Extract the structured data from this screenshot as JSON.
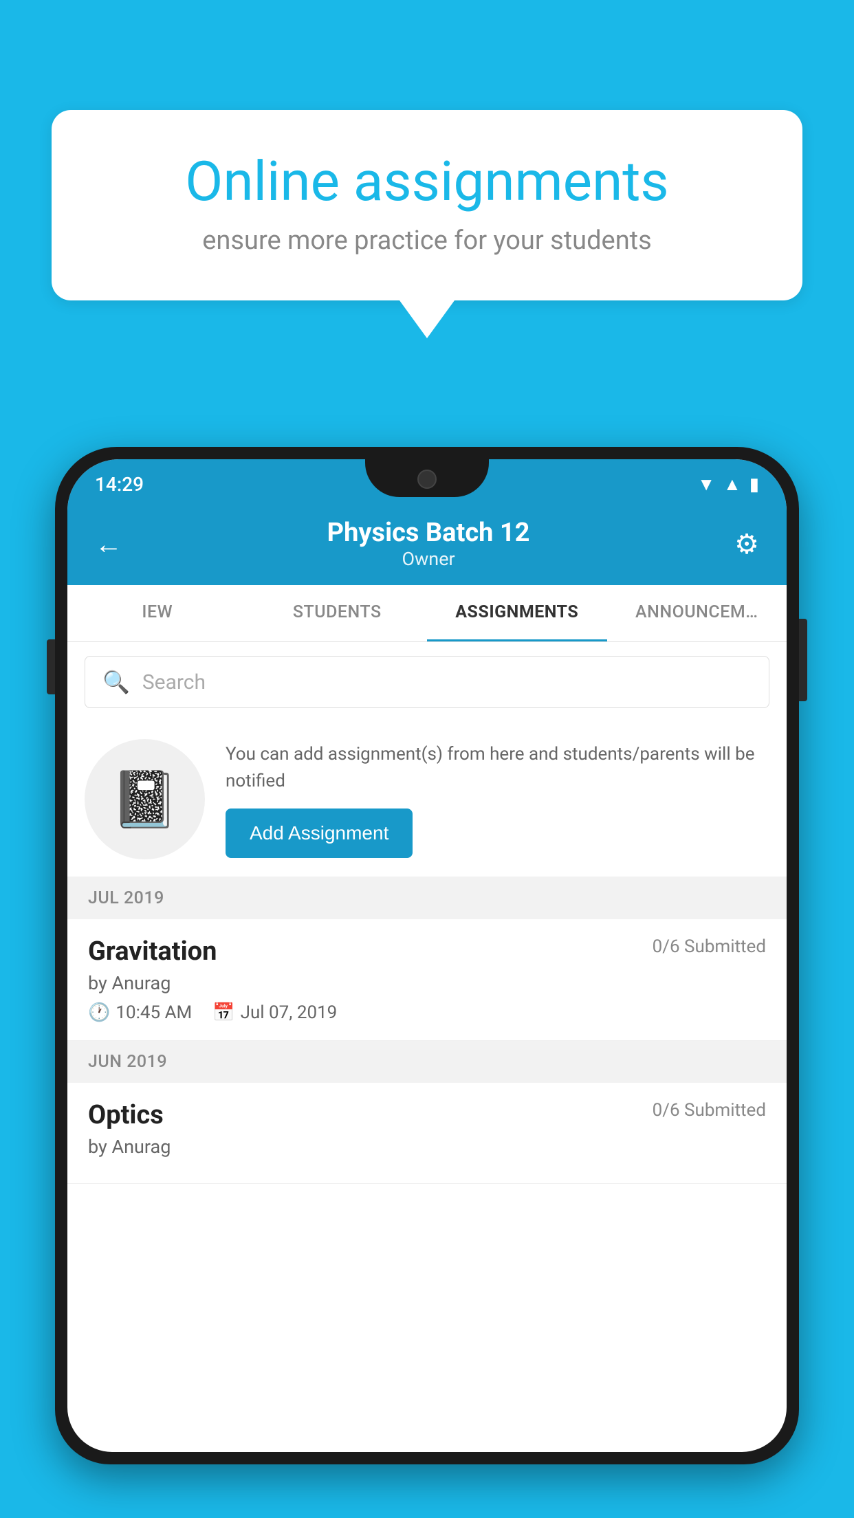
{
  "background_color": "#1ab8e8",
  "speech_bubble": {
    "title": "Online assignments",
    "subtitle": "ensure more practice for your students"
  },
  "status_bar": {
    "time": "14:29",
    "icons": [
      "wifi",
      "signal",
      "battery"
    ]
  },
  "header": {
    "title": "Physics Batch 12",
    "subtitle": "Owner",
    "back_label": "←",
    "settings_label": "⚙"
  },
  "tabs": [
    {
      "label": "IEW",
      "active": false
    },
    {
      "label": "STUDENTS",
      "active": false
    },
    {
      "label": "ASSIGNMENTS",
      "active": true
    },
    {
      "label": "ANNOUNCEM…",
      "active": false
    }
  ],
  "search": {
    "placeholder": "Search"
  },
  "promo": {
    "description": "You can add assignment(s) from here and students/parents will be notified",
    "button_label": "Add Assignment"
  },
  "sections": [
    {
      "header": "JUL 2019",
      "assignments": [
        {
          "name": "Gravitation",
          "submitted": "0/6 Submitted",
          "by": "by Anurag",
          "time": "10:45 AM",
          "date": "Jul 07, 2019"
        }
      ]
    },
    {
      "header": "JUN 2019",
      "assignments": [
        {
          "name": "Optics",
          "submitted": "0/6 Submitted",
          "by": "by Anurag",
          "time": "",
          "date": ""
        }
      ]
    }
  ]
}
